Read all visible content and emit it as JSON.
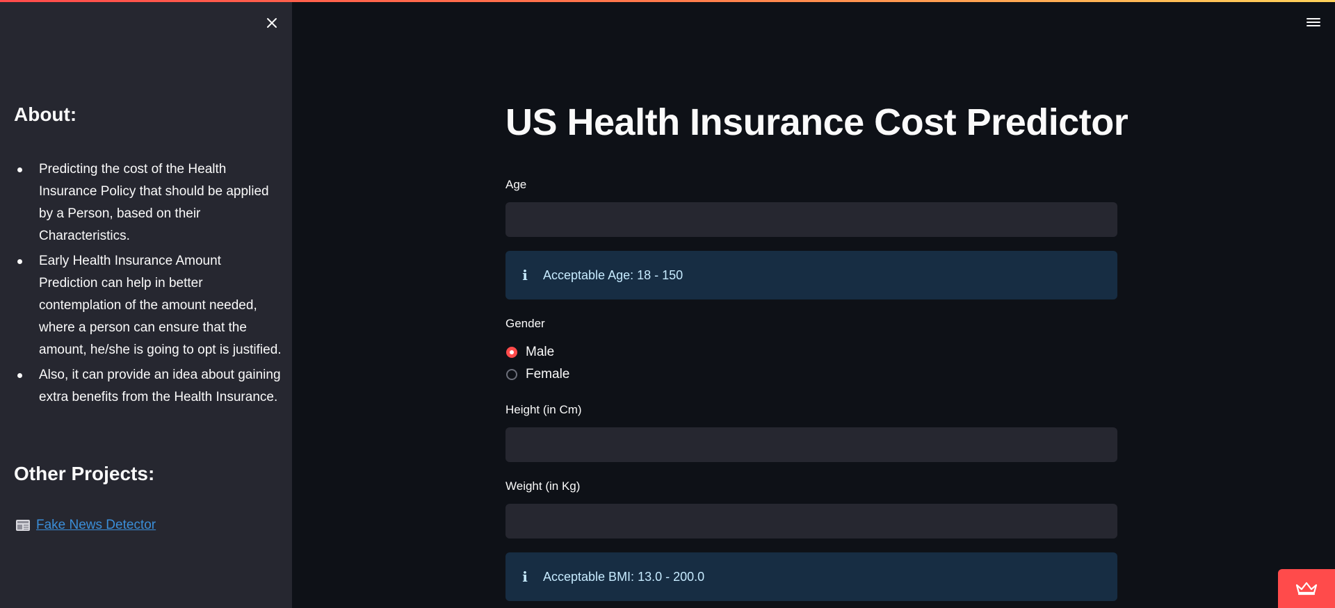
{
  "sidebar": {
    "about_heading": "About:",
    "about_items": [
      "Predicting the cost of the Health Insurance Policy that should be applied by a Person, based on their Characteristics.",
      "Early Health Insurance Amount Prediction can help in better contemplation of the amount needed, where a person can ensure that the amount, he/she is going to opt is justified.",
      "Also, it can provide an idea about gaining extra benefits from the Health Insurance."
    ],
    "other_heading": "Other Projects:",
    "project_icon": "newspaper-icon",
    "project_link": "Fake News Detector"
  },
  "main": {
    "title": "US Health Insurance Cost Predictor",
    "age_label": "Age",
    "age_value": "",
    "age_info": "Acceptable Age: 18 - 150",
    "gender_label": "Gender",
    "gender_options": [
      "Male",
      "Female"
    ],
    "gender_selected": "Male",
    "height_label": "Height (in Cm)",
    "height_value": "",
    "weight_label": "Weight (in Kg)",
    "weight_value": "",
    "bmi_info": "Acceptable BMI: 13.0 - 200.0"
  },
  "icons": {
    "close": "close-icon",
    "menu": "hamburger-menu-icon",
    "info": "info-icon",
    "badge": "crown-icon"
  },
  "colors": {
    "accent": "#ff4b4b",
    "background": "#0e1117",
    "sidebar": "#262730",
    "info_bg": "#172d43",
    "link": "#3b8ed8"
  }
}
